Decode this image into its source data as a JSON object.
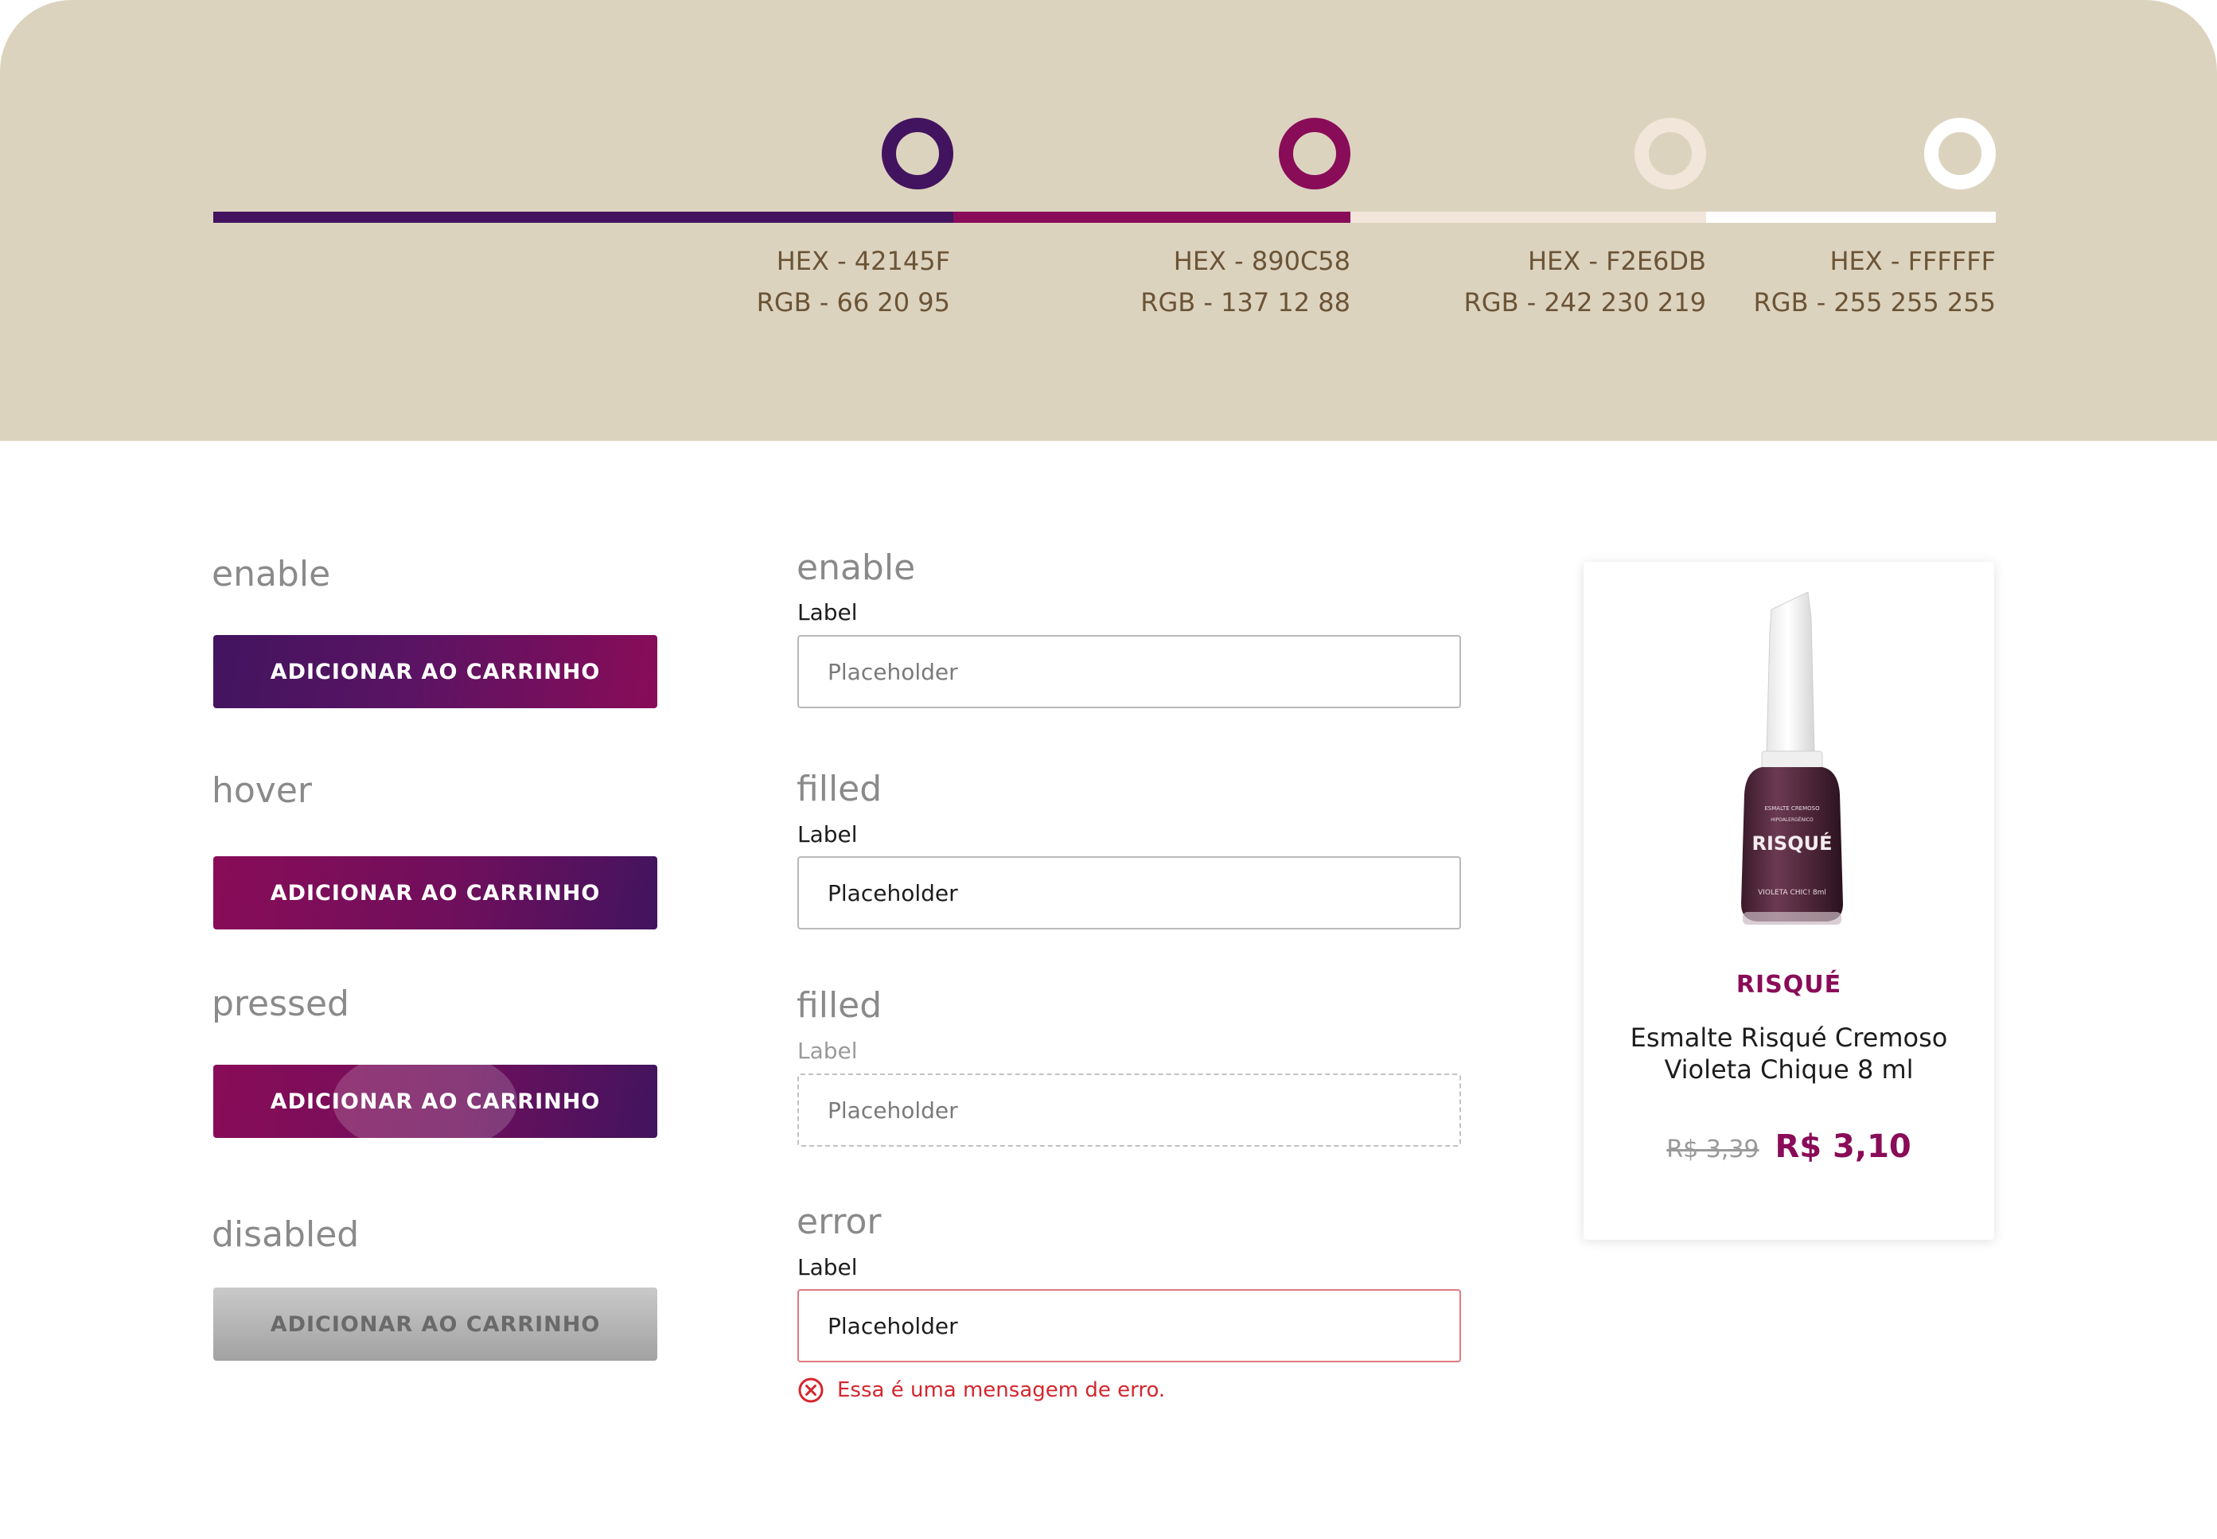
{
  "palette": {
    "colors": [
      {
        "hex_label": "HEX - 42145F",
        "rgb_label": "RGB - 66 20 95",
        "hex": "#42145F"
      },
      {
        "hex_label": "HEX - 890C58",
        "rgb_label": "RGB - 137 12 88",
        "hex": "#890C58"
      },
      {
        "hex_label": "HEX - F2E6DB",
        "rgb_label": "RGB - 242 230 219",
        "hex": "#F2E6DB"
      },
      {
        "hex_label": "HEX - FFFFFF",
        "rgb_label": "RGB - 255 255 255",
        "hex": "#FFFFFF"
      }
    ],
    "background": "#DCD3BF"
  },
  "buttons": {
    "states": [
      {
        "state": "enable",
        "label": "ADICIONAR AO CARRINHO"
      },
      {
        "state": "hover",
        "label": "ADICIONAR AO CARRINHO"
      },
      {
        "state": "pressed",
        "label": "ADICIONAR AO CARRINHO"
      },
      {
        "state": "disabled",
        "label": "ADICIONAR AO CARRINHO"
      }
    ]
  },
  "inputs": {
    "states": [
      {
        "state": "enable",
        "label": "Label",
        "placeholder": "Placeholder"
      },
      {
        "state": "filled",
        "label": "Label",
        "placeholder": "Placeholder"
      },
      {
        "state": "filled",
        "label": "Label",
        "placeholder": "Placeholder"
      },
      {
        "state": "error",
        "label": "Label",
        "placeholder": "Placeholder"
      }
    ],
    "error_message": "Essa é uma mensagem de erro."
  },
  "product": {
    "brand": "RISQUÉ",
    "name": "Esmalte Risqué Cremoso Violeta Chique 8 ml",
    "old_price": "R$ 3,39",
    "price": "R$ 3,10",
    "bottle_brand_text": "RISQUÉ",
    "bottle_shade_text": "VIOLETA CHIC! 8ml"
  },
  "colors": {
    "primary": "#42145F",
    "secondary": "#890C58",
    "error": "#D4262E"
  }
}
